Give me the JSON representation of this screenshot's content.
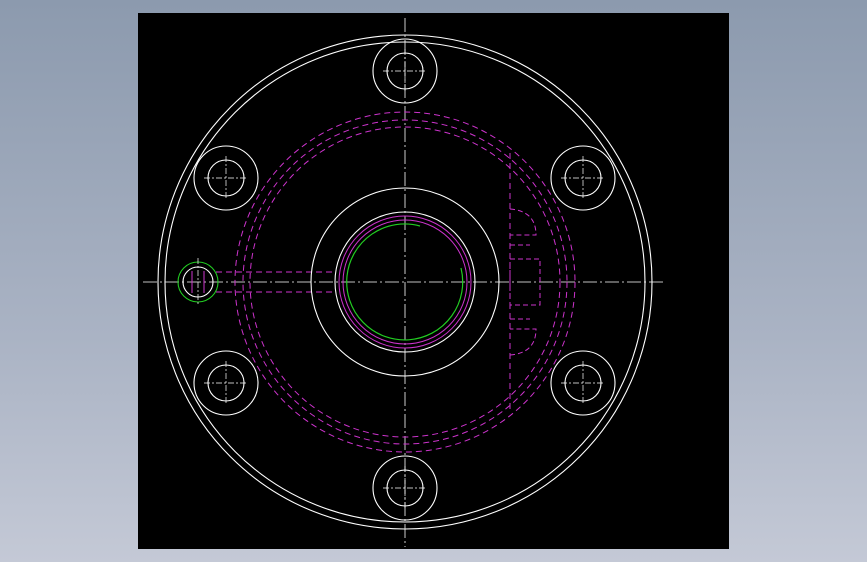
{
  "window": {
    "background_gradient": [
      "#8c9aae",
      "#c4c9d6"
    ],
    "viewport_background": "#000000"
  },
  "drawing": {
    "colors": {
      "outline": "#ffffff",
      "hidden_line": "#cc33cc",
      "highlight": "#22cc22",
      "centerline": "#ffffff"
    },
    "features": {
      "outer_flange": "outer-flange-circle",
      "bolt_holes": "six-bolt-holes",
      "center_bore": "center-bore",
      "hidden_body": "hidden-body-outline",
      "side_port": "side-port-hole",
      "keyway": "hidden-keyway"
    }
  }
}
